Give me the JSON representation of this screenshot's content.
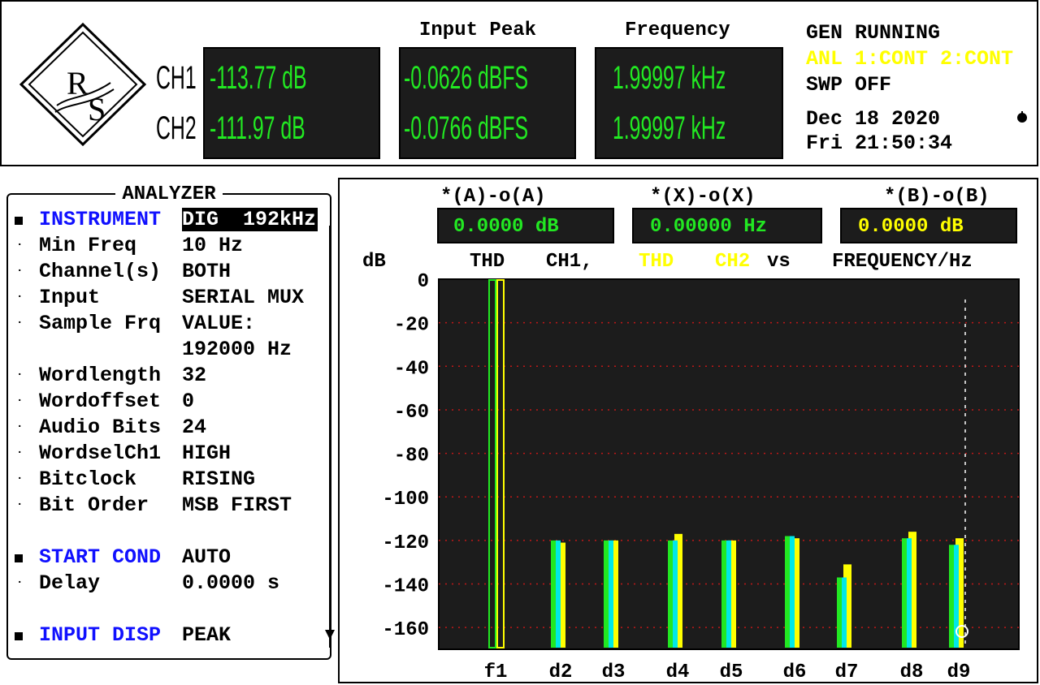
{
  "header": {
    "logo_text": "R&S",
    "channels": [
      "CH1",
      "CH2"
    ],
    "level_values": [
      "-113.77 dB",
      "-111.97 dB"
    ],
    "input_peak_label": "Input Peak",
    "input_peak_values": [
      "-0.0626 dBFS",
      "-0.0766 dBFS"
    ],
    "frequency_label": "Frequency",
    "frequency_values": [
      "1.99997 kHz",
      "1.99997 kHz"
    ],
    "status": {
      "gen": "GEN RUNNING",
      "anl": "ANL 1:CONT 2:CONT",
      "swp": "SWP OFF",
      "date": "Dec 18 2020",
      "time": "Fri 21:50:34"
    }
  },
  "analyzer": {
    "title": "ANALYZER",
    "rows": [
      {
        "name": "INSTRUMENT",
        "value": "DIG  192kHz",
        "bullet": true,
        "highlight": true
      },
      {
        "name": "Min Freq",
        "value": "10 Hz"
      },
      {
        "name": "Channel(s)",
        "value": "BOTH"
      },
      {
        "name": "Input",
        "value": "SERIAL MUX"
      },
      {
        "name": "Sample Frq",
        "value": "VALUE:"
      },
      {
        "name": "",
        "value": "192000 Hz",
        "nodash": true
      },
      {
        "name": "Wordlength",
        "value": "32"
      },
      {
        "name": "Wordoffset",
        "value": "0"
      },
      {
        "name": "Audio Bits",
        "value": "24"
      },
      {
        "name": "WordselCh1",
        "value": "HIGH"
      },
      {
        "name": "Bitclock",
        "value": "RISING"
      },
      {
        "name": "Bit Order",
        "value": "MSB FIRST"
      },
      {
        "name": "START COND",
        "value": "AUTO",
        "bullet": true,
        "gap": true
      },
      {
        "name": "Delay",
        "value": "0.0000 s"
      },
      {
        "name": "INPUT DISP",
        "value": "PEAK",
        "bullet": true,
        "gap": true
      }
    ]
  },
  "markers": [
    {
      "label": "*(A)-o(A)",
      "value": "0.0000 dB",
      "color": "#22e822"
    },
    {
      "label": "*(X)-o(X)",
      "value": "0.00000 Hz",
      "color": "#22e822"
    },
    {
      "label": "*(B)-o(B)",
      "value": "0.0000 dB",
      "color": "#ffff00"
    }
  ],
  "chart_data": {
    "type": "bar",
    "ylabel": "dB",
    "title_parts": {
      "t1": "THD",
      "t2": "CH1,",
      "t3": "THD",
      "t4": "CH2",
      "t5": "vs",
      "t6": "FREQUENCY/Hz"
    },
    "ylim": [
      -170,
      0
    ],
    "yticks": [
      "0",
      "-20",
      "-40",
      "-60",
      "-80",
      "-100",
      "-120",
      "-140",
      "-160"
    ],
    "categories": [
      "f1",
      "d2",
      "d3",
      "d4",
      "d5",
      "d6",
      "d7",
      "d8",
      "d9"
    ],
    "series": [
      {
        "name": "THD CH1",
        "color": "#22e822",
        "values": [
          0,
          -120,
          -120,
          -120,
          -120,
          -118,
          -137,
          -119,
          -122
        ]
      },
      {
        "name": "THD CH2",
        "color": "#ffff00",
        "values": [
          0,
          -121,
          -120,
          -117,
          -120,
          -119,
          -131,
          -116,
          -119
        ]
      }
    ],
    "grid": true
  },
  "colors": {
    "display_bg": "#1c1c1c",
    "green": "#22e822",
    "yellow": "#ffff00",
    "cyan": "#00e8e8",
    "blue": "#1010ff"
  }
}
